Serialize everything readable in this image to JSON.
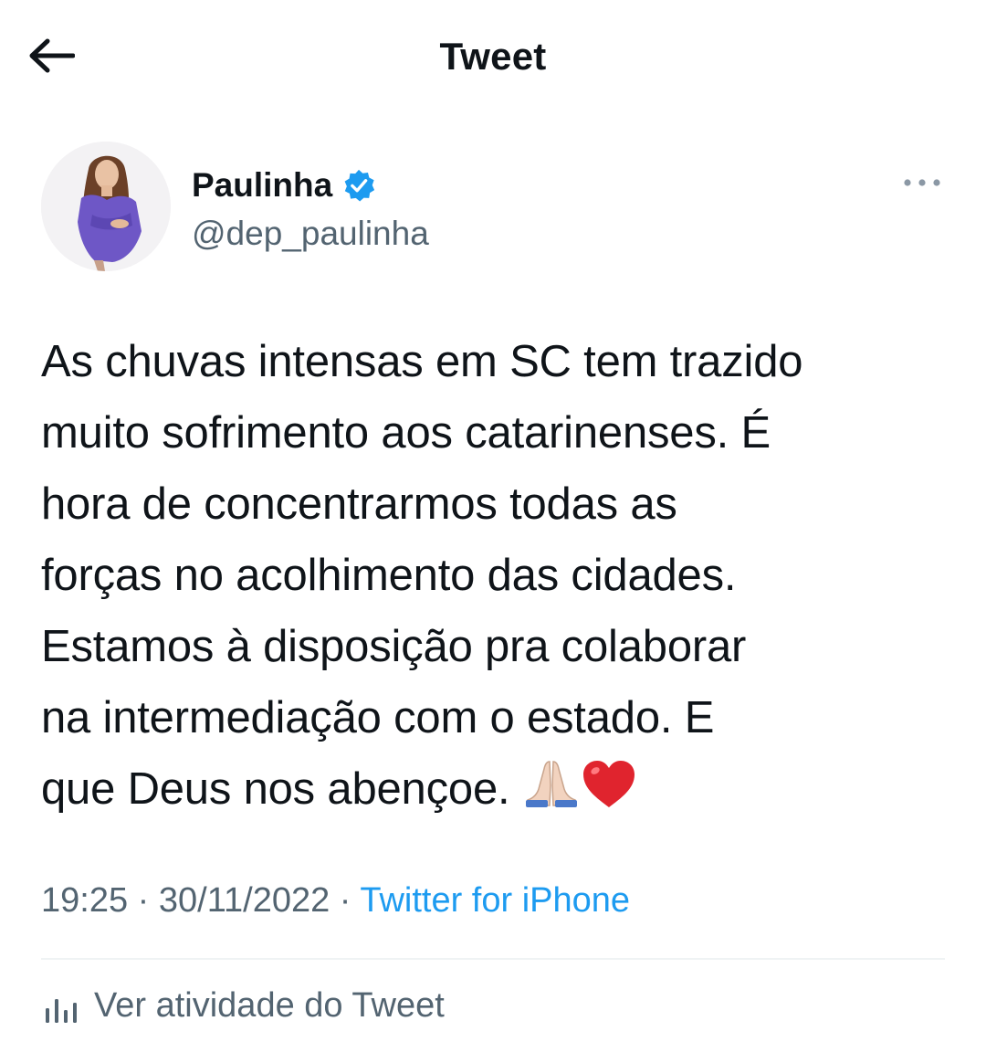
{
  "header": {
    "title": "Tweet",
    "back_icon": "arrow-left-icon"
  },
  "author": {
    "display_name": "Paulinha",
    "handle": "@dep_paulinha",
    "verified": true,
    "verified_color": "#1d9bf0",
    "more_icon": "more-dots-icon"
  },
  "tweet": {
    "lines": [
      "As chuvas intensas em SC tem trazido",
      "muito sofrimento aos catarinenses. É",
      "hora de concentrarmos todas as",
      "forças no acolhimento das cidades.",
      "Estamos à disposição pra colaborar",
      "na intermediação com o estado. E",
      "que Deus nos abençoe."
    ],
    "emojis": [
      "praying-hands-icon",
      "red-heart-icon"
    ]
  },
  "meta": {
    "time": "19:25",
    "separator": " · ",
    "date": "30/11/2022",
    "source": "Twitter for iPhone",
    "source_color": "#1d9bf0"
  },
  "activity": {
    "label": "Ver atividade do Tweet",
    "icon": "analytics-bars-icon"
  }
}
